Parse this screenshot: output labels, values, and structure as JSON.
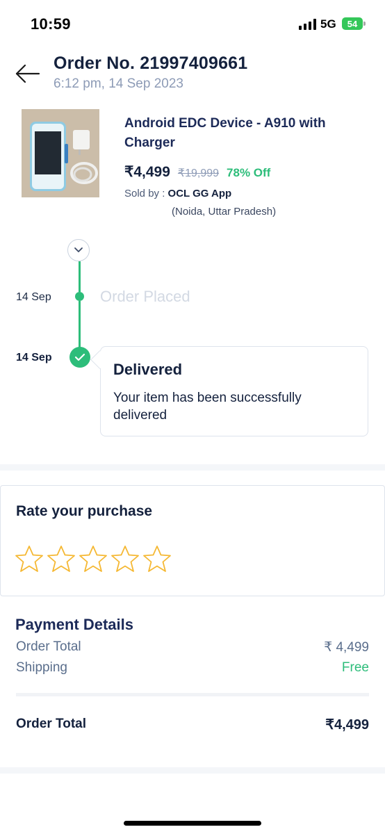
{
  "status_bar": {
    "time": "10:59",
    "network": "5G",
    "battery": "54",
    "battery_color": "#34c759",
    "signal_icon": "cellular-signal-icon"
  },
  "header": {
    "back_icon": "arrow-left-icon",
    "title": "Order No. 21997409661",
    "date": "6:12 pm, 14 Sep 2023"
  },
  "product": {
    "name": "Android EDC Device - A910 with Charger",
    "price": "₹4,499",
    "mrp": "₹19,999",
    "discount": "78% Off",
    "sold_by_label": "Sold by : ",
    "seller": "OCL GG App",
    "seller_location": "(Noida, Uttar Pradesh)"
  },
  "timeline": {
    "toggle_icon": "chevron-down-icon",
    "events": [
      {
        "date": "14 Sep",
        "status": "Order Placed"
      },
      {
        "date": "14 Sep",
        "status": "Delivered",
        "description": "Your item has been successfully delivered"
      }
    ],
    "accent": "#2dbd7a"
  },
  "rating": {
    "title": "Rate your purchase",
    "max_stars": 5,
    "selected": 0,
    "star_color": "#f5b833"
  },
  "payment": {
    "title": "Payment Details",
    "rows": [
      {
        "label": "Order Total",
        "value": "₹ 4,499"
      },
      {
        "label": "Shipping",
        "value": "Free"
      }
    ],
    "total_label": "Order Total",
    "total_value": "₹4,499"
  }
}
